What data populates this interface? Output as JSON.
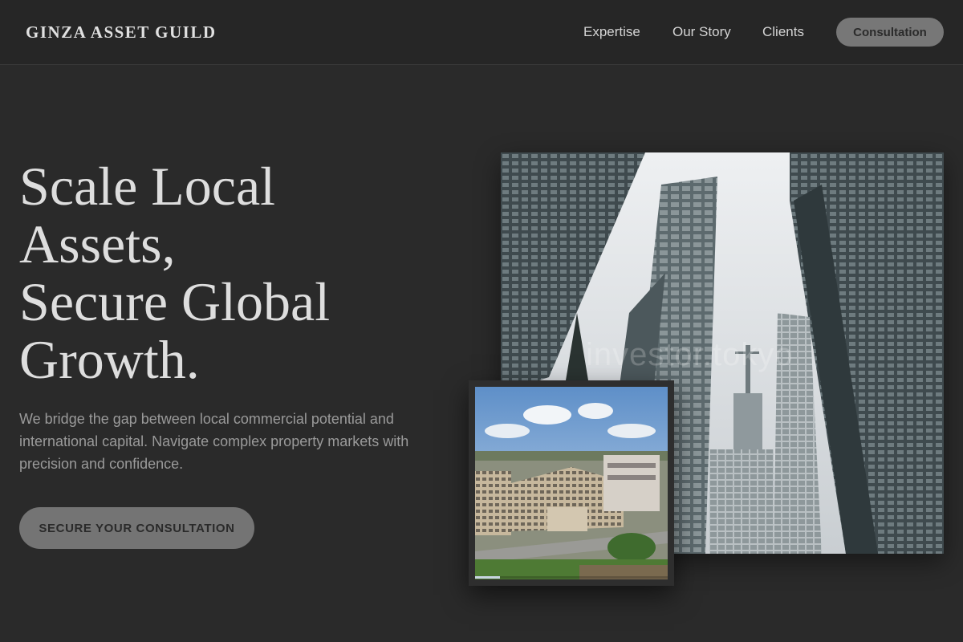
{
  "header": {
    "brand": "GINZA ASSET GUILD",
    "nav": [
      "Expertise",
      "Our Story",
      "Clients"
    ],
    "cta": "Consultation"
  },
  "hero": {
    "headline": [
      "Scale Local",
      "Assets,",
      "Secure Global",
      "Growth."
    ],
    "intro": "We bridge the gap between local commercial potential and international capital. Navigate complex property markets with precision and confidence.",
    "cta": "SECURE YOUR CONSULTATION"
  },
  "gallery": {
    "main_icon": "skyscrapers-photo",
    "inset_icon": "commercial-building-aerial-photo",
    "watermark": "investor.tokyo",
    "slide_progress": 0.13
  },
  "colors": {
    "background": "#2a2a2a",
    "header": "#262626",
    "button": "#777777",
    "text": "#dedede",
    "muted": "#9a9a9a"
  }
}
